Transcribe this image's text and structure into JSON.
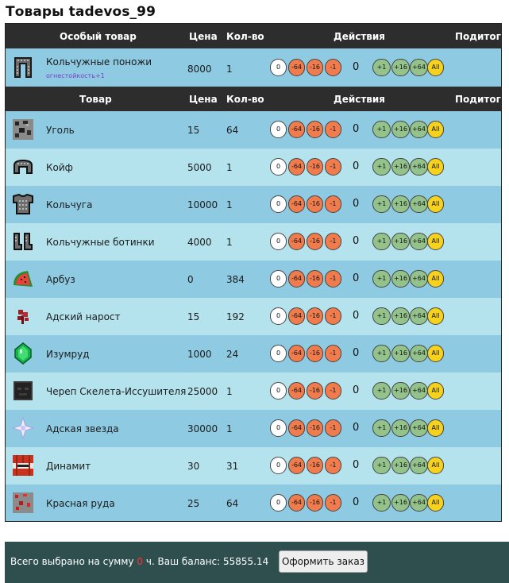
{
  "page": {
    "title": "Товары tadevos_99"
  },
  "special_header": {
    "item": "Особый товар",
    "price": "Цена",
    "qty": "Кол-во",
    "actions": "Действия",
    "subtotal": "Подитог"
  },
  "special": {
    "name": "Кольчужные поножи",
    "enchant": "огнестойкость+1",
    "price": "8000",
    "qty": "1",
    "count": "0",
    "icon": "chainmail-leggings-icon"
  },
  "header": {
    "item": "Товар",
    "price": "Цена",
    "qty": "Кол-во",
    "actions": "Действия",
    "subtotal": "Подитог"
  },
  "buttons": {
    "zero": "0",
    "m64": "-64",
    "m16": "-16",
    "m1": "-1",
    "p1": "+1",
    "p16": "+16",
    "p64": "+64",
    "all": "All"
  },
  "items": [
    {
      "name": "Уголь",
      "price": "15",
      "qty": "64",
      "count": "0",
      "icon": "coal-icon"
    },
    {
      "name": "Койф",
      "price": "5000",
      "qty": "1",
      "count": "0",
      "icon": "chainmail-helmet-icon"
    },
    {
      "name": "Кольчуга",
      "price": "10000",
      "qty": "1",
      "count": "0",
      "icon": "chainmail-chestplate-icon"
    },
    {
      "name": "Кольчужные ботинки",
      "price": "4000",
      "qty": "1",
      "count": "0",
      "icon": "chainmail-boots-icon"
    },
    {
      "name": "Арбуз",
      "price": "0",
      "qty": "384",
      "count": "0",
      "icon": "melon-icon"
    },
    {
      "name": "Адский нарост",
      "price": "15",
      "qty": "192",
      "count": "0",
      "icon": "nether-wart-icon"
    },
    {
      "name": "Изумруд",
      "price": "1000",
      "qty": "24",
      "count": "0",
      "icon": "emerald-icon"
    },
    {
      "name": "Череп Скелета-Иссушителя",
      "price": "25000",
      "qty": "1",
      "count": "0",
      "icon": "wither-skull-icon"
    },
    {
      "name": "Адская звезда",
      "price": "30000",
      "qty": "1",
      "count": "0",
      "icon": "nether-star-icon"
    },
    {
      "name": "Динамит",
      "price": "30",
      "qty": "31",
      "count": "0",
      "icon": "tnt-icon"
    },
    {
      "name": "Красная руда",
      "price": "25",
      "qty": "64",
      "count": "0",
      "icon": "redstone-ore-icon"
    }
  ],
  "footer": {
    "prefix": "Всего выбрано на сумму",
    "sum": "0",
    "suffix": "ч. Ваш баланс: 55855.14",
    "order_button": "Оформить заказ"
  }
}
